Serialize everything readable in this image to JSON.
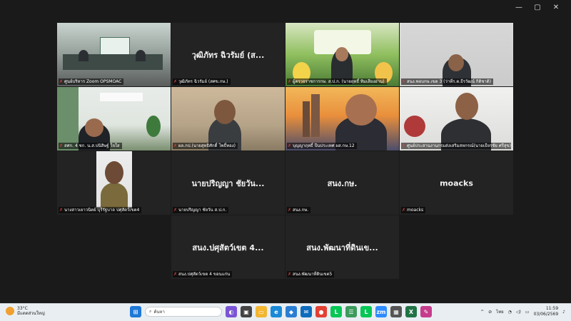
{
  "window": {
    "minimize": "—",
    "maximize": "▢",
    "close": "✕"
  },
  "tiles": [
    {
      "label": "ศูนย์บริหาร Zoom OPSMOAC",
      "big": "",
      "active": false
    },
    {
      "label": "วุฒิภัทร ฉิวรัมย์ (สศข.กษ.)",
      "big": "วุฒิภัทร ฉิวรัมย์ (ส...",
      "active": false
    },
    {
      "label": "ผู้ตรวจราชการกษ. ส.ป.ก. (นายฤทธิ์ ทิมเสียงอ่าน)",
      "big": "",
      "active": false
    },
    {
      "label": "สนง.พอบกษ.เขต 3 (ว่าที่ร.ต.ธีรวัฒน์ กิติชาติ)",
      "big": "",
      "active": false
    },
    {
      "label": "สศก. 4 ชก. น.ส.ปนิสิษฐ์ ใจใส",
      "big": "",
      "active": false
    },
    {
      "label": "ผล.กป.(นายสุทธิศักดิ์ โพธิ์ทอง)",
      "big": "",
      "active": false
    },
    {
      "label": "บุญญาฤทธิ์ ปีนประเทศ ผส.กษ.12",
      "big": "",
      "active": true
    },
    {
      "label": "ศูนย์ประสานงานกรมส่งเสริมสหกรณ์(นายเธียรชัย ศรีสุข)",
      "big": "",
      "active": false
    },
    {
      "label": "นางสาวเยาวนิตย์ บุรีรัฐบาล ปศุสัตว์เขต4",
      "big": "",
      "active": false
    },
    {
      "label": "นายปริญญา ชัยวัน ส.ป.ก.",
      "big": "นายปริญญา ชัยวัน...",
      "active": false
    },
    {
      "label": "สนง.กษ.",
      "big": "สนง.กษ.",
      "active": false
    },
    {
      "label": "moacks",
      "big": "moacks",
      "active": false
    },
    {
      "label": "สนง.ปศุสัตว์เขต 4 ขอนแก่น",
      "big": "สนง.ปศุสัตว์เขต 4...",
      "active": false
    },
    {
      "label": "สนง.พัฒนาที่ดินเขต5",
      "big": "สนง.พัฒนาที่ดินเข...",
      "active": false
    }
  ],
  "taskbar": {
    "temp": "33°C",
    "weather": "มีแดดส่วนใหญ่",
    "search_placeholder": "ค้นหา",
    "lang": "ไทย",
    "time": "11:59",
    "date": "03/06/2569"
  },
  "colors": {
    "active_outline": "#5ec46a",
    "mic_muted": "#e2423a"
  }
}
